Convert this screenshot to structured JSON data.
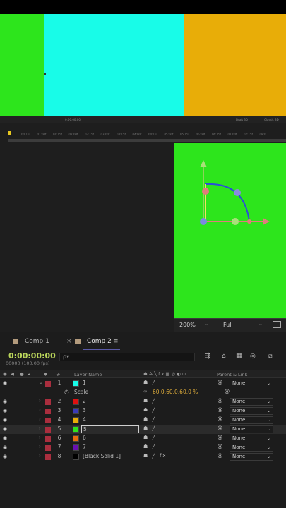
{
  "viewer_top": {
    "strips": [
      {
        "name": "green",
        "color": "#2de51c"
      },
      {
        "name": "cyan",
        "color": "#18fce8"
      },
      {
        "name": "orange",
        "color": "#e8ad08"
      }
    ],
    "toolbar_items": [
      "0:00:00:00",
      "Draft 3D",
      "Classic 3D"
    ]
  },
  "ruler_ticks": [
    "00:15f",
    "01:00f",
    "01:15f",
    "02:00f",
    "02:15f",
    "03:00f",
    "03:15f",
    "04:00f",
    "04:15f",
    "05:00f",
    "05:15f",
    "06:00f",
    "06:15f",
    "07:00f",
    "07:15f",
    "08:0"
  ],
  "viewer_mid": {
    "zoom": "200%",
    "resolution": "Full"
  },
  "tabs": [
    {
      "label": "Comp 1"
    },
    {
      "label": "Comp 2"
    }
  ],
  "timecode": "0:00:00:00",
  "fps": "00000 (100.00 fps)",
  "search_placeholder": "ρ▾",
  "headers": {
    "num": "#",
    "layer_name": "Layer Name",
    "parent": "Parent & Link"
  },
  "property_row": {
    "name": "Scale",
    "value": "60.0,60.0,60.0 %"
  },
  "layers": [
    {
      "num": "1",
      "name": "1",
      "color": "#18fce8",
      "parent": "None",
      "expanded": true
    },
    {
      "num": "2",
      "name": "2",
      "color": "#e01010",
      "parent": "None"
    },
    {
      "num": "3",
      "name": "3",
      "color": "#3a3ab8",
      "parent": "None"
    },
    {
      "num": "4",
      "name": "4",
      "color": "#e8ad08",
      "parent": "None"
    },
    {
      "num": "5",
      "name": "5",
      "color": "#2de51c",
      "parent": "None",
      "selected": true
    },
    {
      "num": "6",
      "name": "6",
      "color": "#e66c0c",
      "parent": "None"
    },
    {
      "num": "7",
      "name": "7",
      "color": "#6a10b0",
      "parent": "None"
    },
    {
      "num": "8",
      "name": "[Black Solid 1]",
      "color": "#000000",
      "parent": "None",
      "fx": true
    }
  ],
  "parent_none": "None"
}
